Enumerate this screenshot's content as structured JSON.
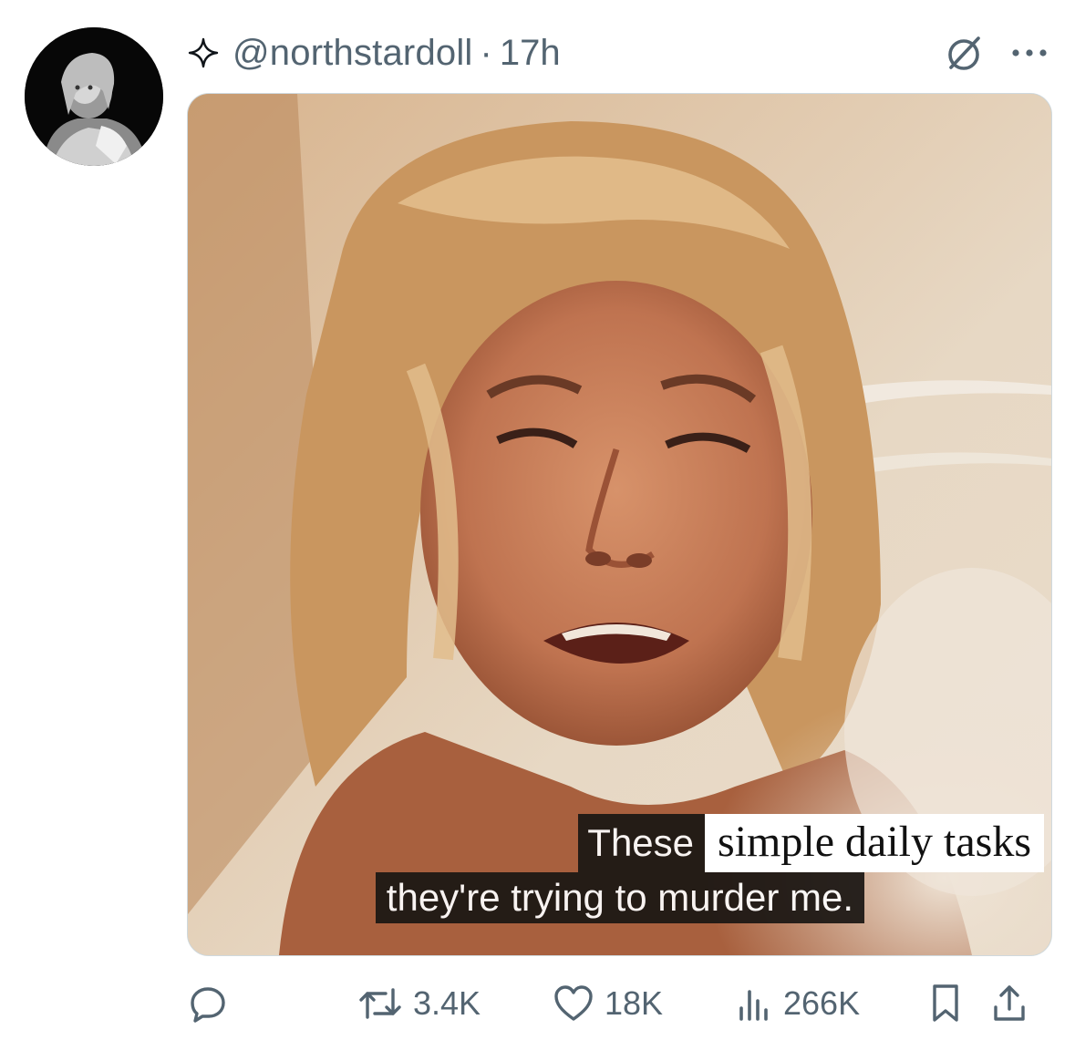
{
  "post": {
    "handle": "@northstardoll",
    "separator": "·",
    "time": "17h"
  },
  "media": {
    "caption_part1": "These",
    "caption_part2": "simple daily tasks",
    "caption_line2": "they're trying to murder me."
  },
  "actions": {
    "reply_icon": "speech-bubble",
    "repost_count": "3.4K",
    "like_count": "18K",
    "views_count": "266K"
  },
  "colors": {
    "muted_text": "#536471",
    "border": "#cfd9de"
  }
}
